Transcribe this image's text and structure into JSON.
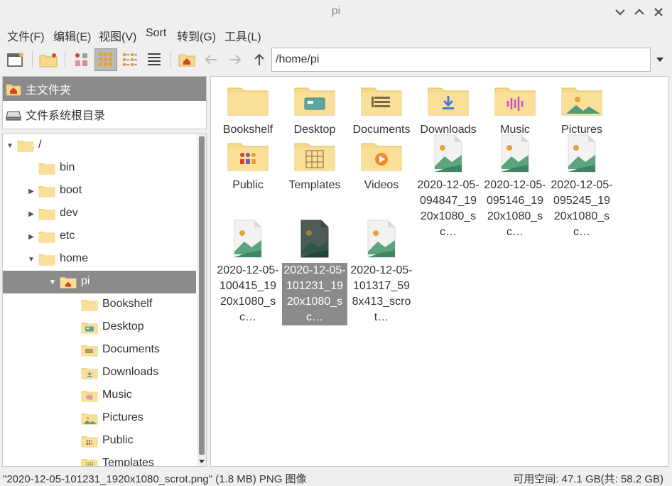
{
  "window": {
    "title": "pi"
  },
  "menu": [
    "文件(F)",
    "编辑(E)",
    "视图(V)",
    "Sort",
    "转到(G)",
    "工具(L)"
  ],
  "toolbar": {
    "path": "/home/pi"
  },
  "places": [
    {
      "label": "主文件夹",
      "icon": "home-icon",
      "selected": true
    },
    {
      "label": "文件系统根目录",
      "icon": "drive-icon",
      "selected": false
    }
  ],
  "tree": [
    {
      "label": "/",
      "depth": 0,
      "arrow": "expanded",
      "icon": "folder-icon"
    },
    {
      "label": "bin",
      "depth": 1,
      "arrow": "none",
      "icon": "folder-icon"
    },
    {
      "label": "boot",
      "depth": 1,
      "arrow": "collapsed",
      "icon": "folder-icon"
    },
    {
      "label": "dev",
      "depth": 1,
      "arrow": "collapsed",
      "icon": "folder-icon"
    },
    {
      "label": "etc",
      "depth": 1,
      "arrow": "collapsed",
      "icon": "folder-icon"
    },
    {
      "label": "home",
      "depth": 1,
      "arrow": "expanded",
      "icon": "folder-icon"
    },
    {
      "label": "pi",
      "depth": 2,
      "arrow": "expanded",
      "icon": "home-folder-icon",
      "selected": true
    },
    {
      "label": "Bookshelf",
      "depth": 3,
      "arrow": "none",
      "icon": "folder-icon"
    },
    {
      "label": "Desktop",
      "depth": 3,
      "arrow": "none",
      "icon": "desktop-folder-icon"
    },
    {
      "label": "Documents",
      "depth": 3,
      "arrow": "none",
      "icon": "documents-folder-icon"
    },
    {
      "label": "Downloads",
      "depth": 3,
      "arrow": "none",
      "icon": "downloads-folder-icon"
    },
    {
      "label": "Music",
      "depth": 3,
      "arrow": "none",
      "icon": "music-folder-icon"
    },
    {
      "label": "Pictures",
      "depth": 3,
      "arrow": "none",
      "icon": "pictures-folder-icon"
    },
    {
      "label": "Public",
      "depth": 3,
      "arrow": "none",
      "icon": "public-folder-icon"
    },
    {
      "label": "Templates",
      "depth": 3,
      "arrow": "none",
      "icon": "templates-folder-icon"
    }
  ],
  "files": [
    {
      "name": "Bookshelf",
      "icon": "folder"
    },
    {
      "name": "Desktop",
      "icon": "desktop"
    },
    {
      "name": "Documents",
      "icon": "documents"
    },
    {
      "name": "Downloads",
      "icon": "downloads"
    },
    {
      "name": "Music",
      "icon": "music"
    },
    {
      "name": "Pictures",
      "icon": "pictures"
    },
    {
      "name": "Public",
      "icon": "public"
    },
    {
      "name": "Templates",
      "icon": "templates"
    },
    {
      "name": "Videos",
      "icon": "videos"
    },
    {
      "name": "2020-12-05-094847_1920x1080_sc…",
      "icon": "image"
    },
    {
      "name": "2020-12-05-095146_1920x1080_sc…",
      "icon": "image"
    },
    {
      "name": "2020-12-05-095245_1920x1080_sc…",
      "icon": "image"
    },
    {
      "name": "2020-12-05-100415_1920x1080_sc…",
      "icon": "image"
    },
    {
      "name": "2020-12-05-101231_1920x1080_sc…",
      "icon": "image",
      "selected": true
    },
    {
      "name": "2020-12-05-101317_598x413_scrot…",
      "icon": "image"
    }
  ],
  "status": {
    "left": "\"2020-12-05-101231_1920x1080_scrot.png\" (1.8 MB) PNG 图像",
    "right": "可用空间: 47.1 GB(共: 58.2 GB)"
  },
  "colors": {
    "folder": "#f7d98a",
    "folder_dark": "#e9c56a",
    "selection": "#8b8b8b",
    "accent_red": "#d9432c"
  }
}
